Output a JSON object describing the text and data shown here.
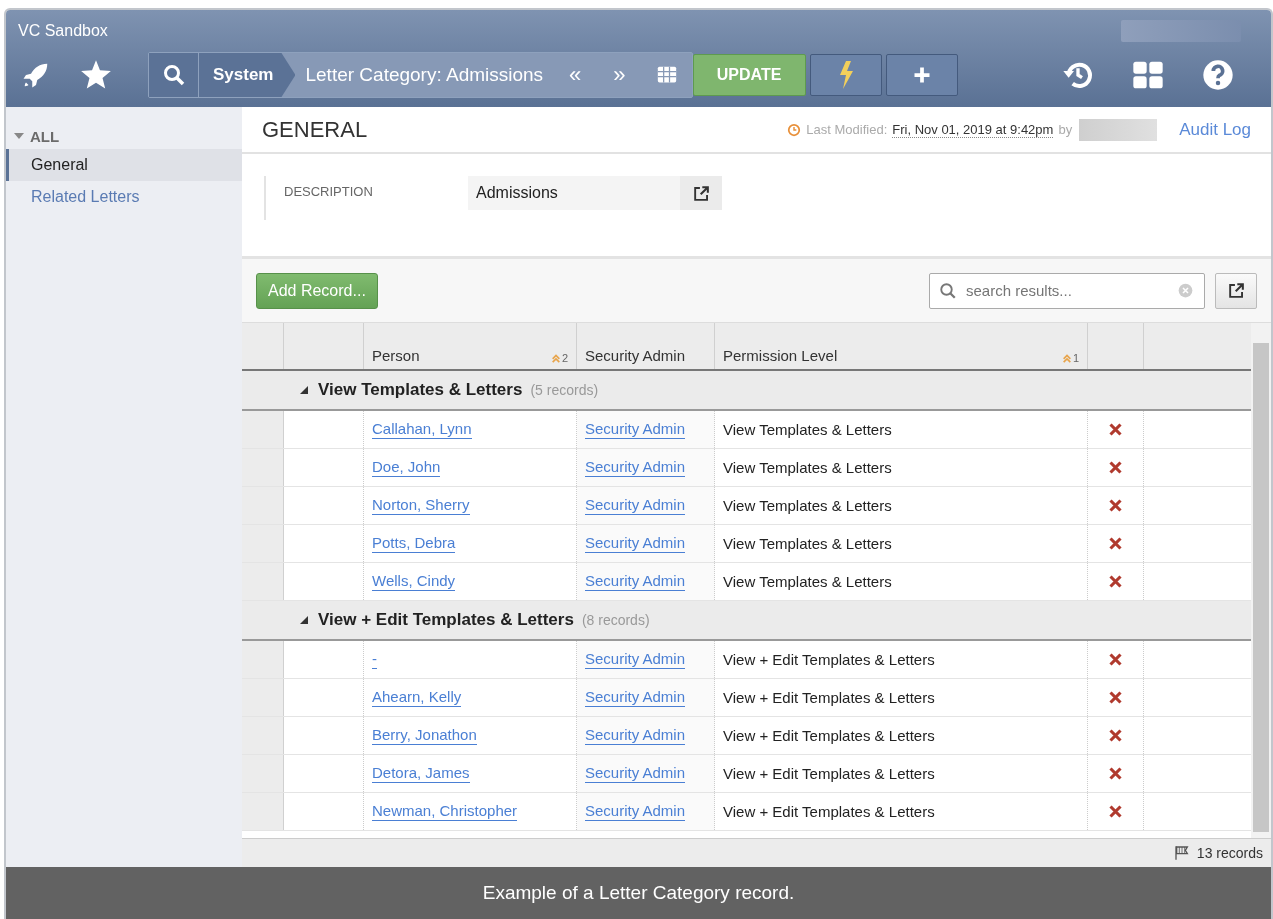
{
  "window": {
    "title": "VC Sandbox"
  },
  "toolbar": {
    "module": "System",
    "record_title": "Letter Category: Admissions",
    "prev": "«",
    "next": "»",
    "update_button": "UPDATE"
  },
  "sidebar": {
    "header": "ALL",
    "expanded": true,
    "items": [
      {
        "label": "General",
        "selected": true
      },
      {
        "label": "Related Letters",
        "selected": false
      }
    ]
  },
  "section": {
    "title": "GENERAL",
    "last_modified_label": "Last Modified:",
    "last_modified_value": "Fri, Nov 01, 2019 at 9:42pm",
    "by": "by",
    "audit_link": "Audit Log"
  },
  "description": {
    "label": "DESCRIPTION",
    "value": "Admissions"
  },
  "add_button": "Add Record...",
  "search": {
    "placeholder": "search results..."
  },
  "table": {
    "columns": [
      {
        "label": "Person",
        "sort": "2"
      },
      {
        "label": "Security Admin"
      },
      {
        "label": "Permission Level",
        "sort": "1"
      }
    ],
    "groups": [
      {
        "title": "View Templates & Letters",
        "count": "(5 records)",
        "expanded": true,
        "rows": [
          {
            "person": "Callahan, Lynn",
            "admin": "Security Admin",
            "permission": "View Templates & Letters"
          },
          {
            "person": "Doe, John",
            "admin": "Security Admin",
            "permission": "View Templates & Letters"
          },
          {
            "person": "Norton, Sherry",
            "admin": "Security Admin",
            "permission": "View Templates & Letters"
          },
          {
            "person": "Potts, Debra",
            "admin": "Security Admin",
            "permission": "View Templates & Letters"
          },
          {
            "person": "Wells, Cindy",
            "admin": "Security Admin",
            "permission": "View Templates & Letters"
          }
        ]
      },
      {
        "title": "View + Edit Templates & Letters",
        "count": "(8 records)",
        "expanded": true,
        "rows": [
          {
            "person": "-",
            "admin": "Security Admin",
            "permission": "View + Edit Templates & Letters"
          },
          {
            "person": "Ahearn, Kelly",
            "admin": "Security Admin",
            "permission": "View + Edit Templates & Letters"
          },
          {
            "person": "Berry, Jonathon",
            "admin": "Security Admin",
            "permission": "View + Edit Templates & Letters"
          },
          {
            "person": "Detora, James",
            "admin": "Security Admin",
            "permission": "View + Edit Templates & Letters"
          },
          {
            "person": "Newman, Christopher",
            "admin": "Security Admin",
            "permission": "View + Edit Templates & Letters"
          }
        ]
      }
    ]
  },
  "footer": {
    "count": "13 records"
  },
  "caption": "Example of a Letter Category record."
}
